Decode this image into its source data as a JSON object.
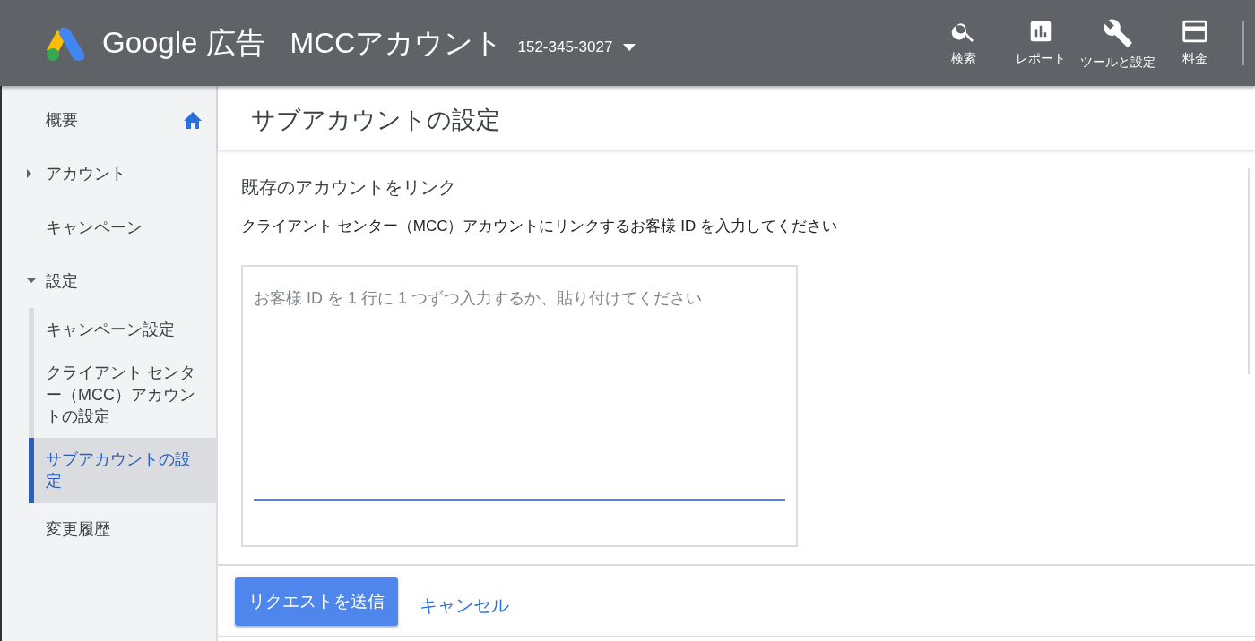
{
  "header": {
    "product": "Google 広告",
    "account_label": "MCCアカウント",
    "account_id": "152-345-3027",
    "actions": [
      {
        "kind": "search",
        "label": "検索"
      },
      {
        "kind": "report",
        "label": "レポート"
      },
      {
        "kind": "tools",
        "label": "ツールと設定"
      },
      {
        "kind": "billing",
        "label": "料金"
      }
    ]
  },
  "sidebar": {
    "items": [
      {
        "kind": "home",
        "label": "概要",
        "selected": false
      },
      {
        "kind": "expandable",
        "label": "アカウント",
        "expanded": false,
        "selected": false
      },
      {
        "kind": "plain",
        "label": "キャンペーン",
        "selected": false
      },
      {
        "kind": "expandable",
        "label": "設定",
        "expanded": true,
        "selected": false,
        "children": [
          {
            "label": "キャンペーン設定",
            "selected": false
          },
          {
            "label": "クライアント センター（MCC）アカウントの設定",
            "selected": false
          },
          {
            "label": "サブアカウントの設定",
            "selected": true
          }
        ]
      },
      {
        "kind": "plain",
        "label": "変更履歴",
        "selected": false
      }
    ]
  },
  "page_title": "サブアカウントの設定",
  "form": {
    "heading": "既存のアカウントをリンク",
    "instructions": "クライアント センター（MCC）アカウントにリンクするお客様 ID を入力してください",
    "ids_field": {
      "placeholder": "お客様 ID を 1 行に 1 つずつ入力するか、貼り付けてください"
    },
    "buttons": [
      {
        "kind": "primary",
        "label": "リクエストを送信"
      },
      {
        "kind": "link",
        "label": "キャンセル"
      }
    ]
  }
}
